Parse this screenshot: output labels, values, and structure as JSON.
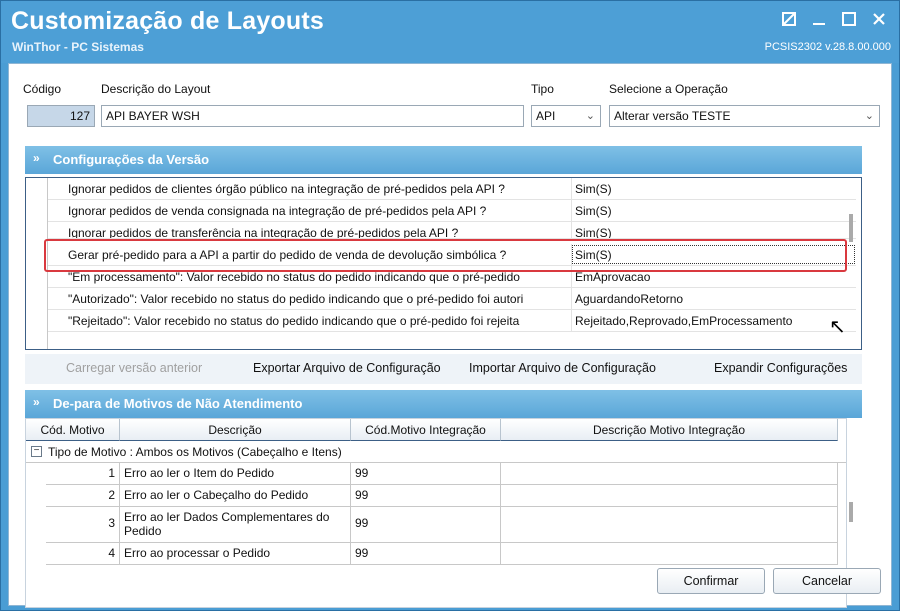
{
  "window": {
    "title": "Customização de Layouts",
    "subtitle": "WinThor - PC Sistemas",
    "version": "PCSIS2302  v.28.8.00.000"
  },
  "header": {
    "code_label": "Código",
    "code_value": "127",
    "desc_label": "Descrição do Layout",
    "desc_value": "API BAYER WSH",
    "type_label": "Tipo",
    "type_value": "API",
    "operation_label": "Selecione a Operação",
    "operation_value": "Alterar versão TESTE"
  },
  "config_section": {
    "title": "Configurações da Versão",
    "rows": [
      {
        "name": "Ignorar pedidos de clientes órgão público na integração de pré-pedidos pela API ?",
        "value": "Sim(S)"
      },
      {
        "name": "Ignorar pedidos de venda consignada na integração de pré-pedidos pela API ?",
        "value": "Sim(S)"
      },
      {
        "name": "Ignorar pedidos de transferência na integração de pré-pedidos pela API ?",
        "value": "Sim(S)"
      },
      {
        "name": "Gerar pré-pedido para a API a partir do pedido de venda de devolução simbólica ?",
        "value": "Sim(S)"
      },
      {
        "name": "\"Em processamento\": Valor recebido no status do pedido indicando que o pré-pedido",
        "value": "EmAprovacao"
      },
      {
        "name": "\"Autorizado\": Valor recebido no status do pedido indicando que o pré-pedido foi autori",
        "value": "AguardandoRetorno"
      },
      {
        "name": "\"Rejeitado\": Valor recebido no status do pedido indicando que o pré-pedido foi rejeita",
        "value": "Rejeitado,Reprovado,EmProcessamento"
      }
    ]
  },
  "toolbar": {
    "load_prev": "Carregar versão anterior",
    "export": "Exportar Arquivo de Configuração",
    "import": "Importar Arquivo de Configuração",
    "expand": "Expandir Configurações"
  },
  "depara_section": {
    "title": "De-para de Motivos de Não Atendimento",
    "columns": [
      "Cód. Motivo",
      "Descrição",
      "Cód.Motivo Integração",
      "Descrição Motivo Integração"
    ],
    "group_label": "Tipo de Motivo : Ambos os Motivos (Cabeçalho e Itens)",
    "rows": [
      {
        "code": "1",
        "desc": "Erro ao ler o Item do Pedido",
        "int_code": "99",
        "int_desc": ""
      },
      {
        "code": "2",
        "desc": "Erro ao ler o Cabeçalho do Pedido",
        "int_code": "99",
        "int_desc": ""
      },
      {
        "code": "3",
        "desc": "Erro ao ler Dados Complementares do Pedido",
        "int_code": "99",
        "int_desc": ""
      },
      {
        "code": "4",
        "desc": "Erro ao processar o Pedido",
        "int_code": "99",
        "int_desc": ""
      }
    ]
  },
  "buttons": {
    "confirm": "Confirmar",
    "cancel": "Cancelar"
  }
}
